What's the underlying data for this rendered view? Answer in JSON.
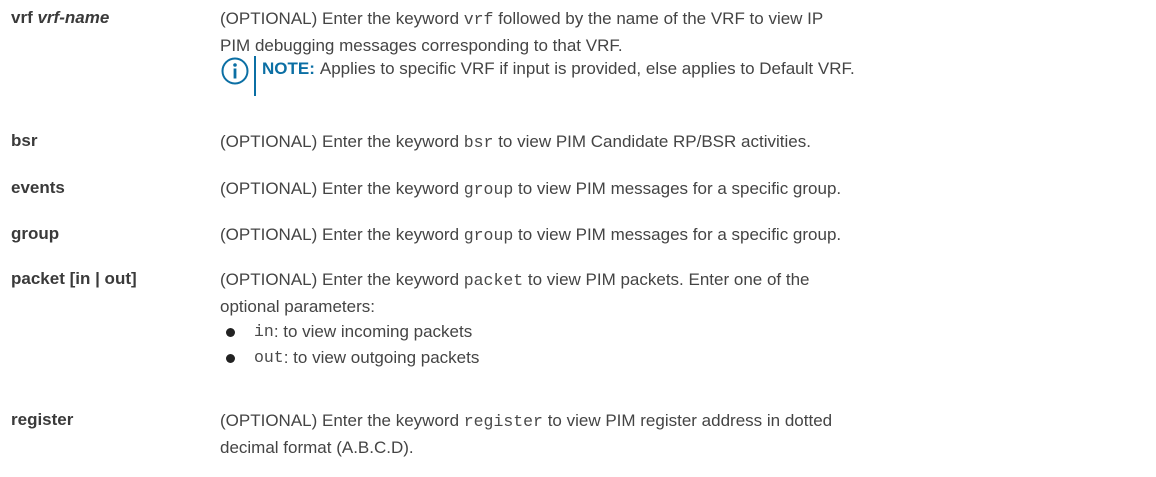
{
  "rows": {
    "vrf": {
      "param_kw": "vrf",
      "param_arg": "vrf-name",
      "desc_line1_a": "(OPTIONAL) Enter the keyword ",
      "desc_line1_code": "vrf",
      "desc_line1_b": " followed by the name of the VRF to view IP",
      "desc_line2": "PIM debugging messages corresponding to that VRF.",
      "note_label": "NOTE:",
      "note_text": "Applies to specific VRF if input is provided, else applies to Default VRF."
    },
    "bsr": {
      "param": "bsr",
      "desc_a": "(OPTIONAL) Enter the keyword ",
      "desc_code": "bsr",
      "desc_b": " to view PIM Candidate RP/BSR activities."
    },
    "events": {
      "param": "events",
      "desc_a": "(OPTIONAL) Enter the keyword ",
      "desc_code": "group",
      "desc_b": " to view PIM messages for a specific group."
    },
    "group": {
      "param": "group",
      "desc_a": "(OPTIONAL) Enter the keyword ",
      "desc_code": "group",
      "desc_b": " to view PIM messages for a specific group."
    },
    "packet": {
      "param": "packet [in | out]",
      "desc_line1_a": "(OPTIONAL) Enter the keyword ",
      "desc_line1_code": "packet",
      "desc_line1_b": " to view PIM packets. Enter one of the",
      "desc_line2": "optional parameters:",
      "options": [
        {
          "code": "in",
          "text": ": to view incoming packets"
        },
        {
          "code": "out",
          "text": ": to view outgoing packets"
        }
      ]
    },
    "register": {
      "param": "register",
      "desc_line1_a": "(OPTIONAL) Enter the keyword ",
      "desc_line1_code": "register",
      "desc_line1_b": " to view PIM register address in dotted",
      "desc_line2": "decimal format (A.B.C.D)."
    }
  },
  "colors": {
    "text": "#444444",
    "accent": "#0b6fa4"
  },
  "icons": {
    "note": "info-icon"
  }
}
